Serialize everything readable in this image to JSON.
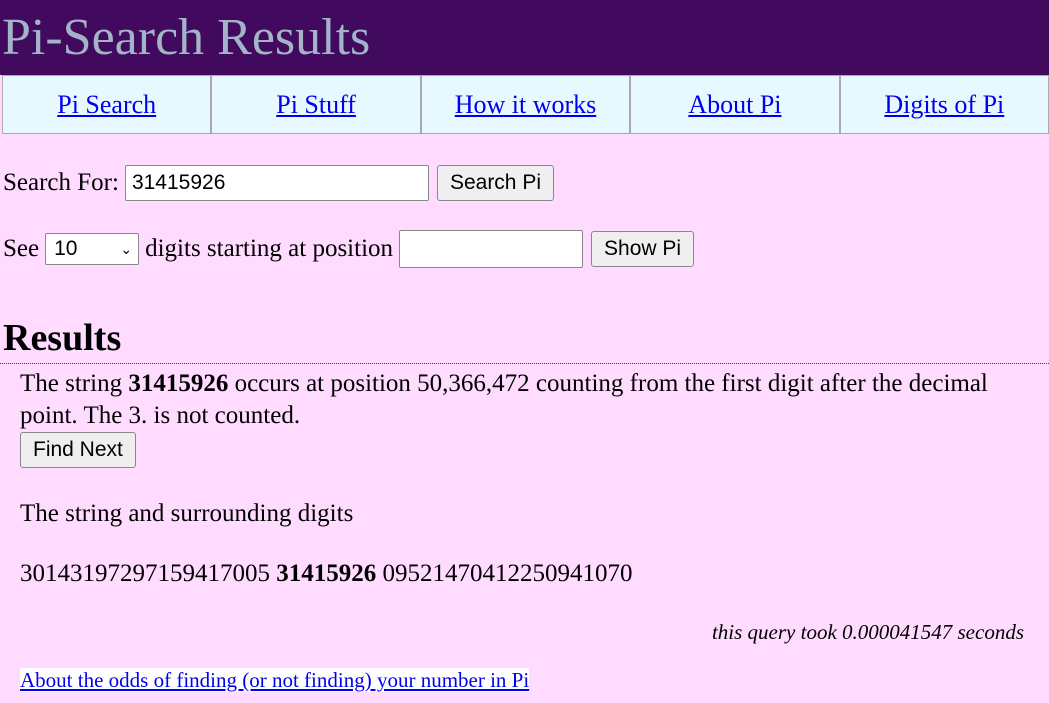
{
  "header": {
    "title": "Pi-Search Results"
  },
  "nav": [
    "Pi Search",
    "Pi Stuff",
    "How it works",
    "About Pi",
    "Digits of Pi"
  ],
  "search": {
    "label": "Search For:",
    "value": "31415926",
    "button": "Search Pi"
  },
  "see": {
    "label_pre": "See",
    "selected": "10",
    "label_post": "digits starting at position",
    "position_value": "",
    "button": "Show Pi"
  },
  "results": {
    "heading": "Results",
    "sentence_pre": "The string ",
    "query": "31415926",
    "sentence_post": " occurs at position 50,366,472 counting from the first digit after the decimal point. The 3. is not counted.",
    "find_next": "Find Next",
    "surrounding_label": "The string and surrounding digits",
    "digits_before": "30143197297159417005",
    "digits_match": "31415926",
    "digits_after": "09521470412250941070",
    "timing": "this query took 0.000041547 seconds",
    "odds_link": "About the odds of finding (or not finding) your number in Pi"
  },
  "colors": {
    "header_bg": "#420a5e",
    "title": "#a3b3c8",
    "nav_bg": "#e8f8ff",
    "page_bg": "#ffdcff",
    "link": "#0000ee"
  }
}
